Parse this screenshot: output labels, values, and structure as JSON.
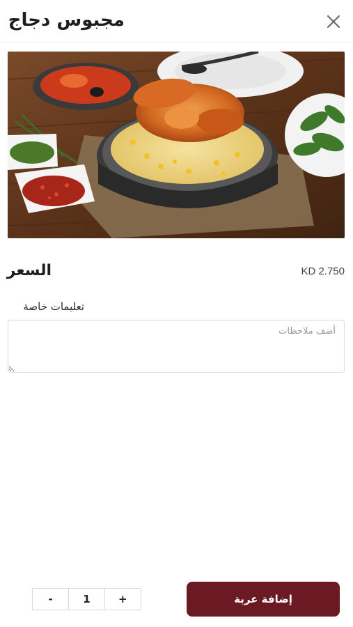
{
  "header": {
    "title": "مجبوس دجاج",
    "close_icon": "close-icon"
  },
  "product": {
    "image_description_icon": "food-photo",
    "price_label": "السعر",
    "price_value": "KD 2.750"
  },
  "instructions": {
    "label": "تعليمات خاصة",
    "placeholder": "أضف ملاحظات",
    "value": ""
  },
  "quantity": {
    "decrement_label": "-",
    "value": "1",
    "increment_label": "+"
  },
  "actions": {
    "add_to_cart_label": "إضافة عربة"
  },
  "colors": {
    "accent": "#6b1a24",
    "border": "#dcdcdc"
  }
}
